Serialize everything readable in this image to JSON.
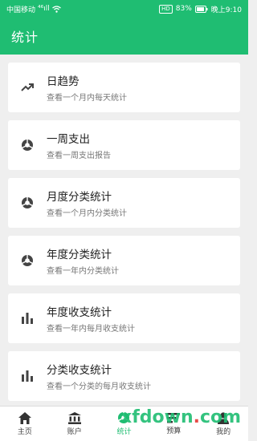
{
  "statusbar": {
    "carrier": "中国移动",
    "signal": "⁴⁶ıll",
    "wifi": "WiFi",
    "hd": "HD",
    "battery": "83%",
    "time": "晚上9:10"
  },
  "appbar": {
    "title": "统计"
  },
  "cards": [
    {
      "title": "日趋势",
      "subtitle": "查看一个月内每天统计",
      "icon": "trend-icon"
    },
    {
      "title": "一周支出",
      "subtitle": "查看一周支出报告",
      "icon": "pie-icon"
    },
    {
      "title": "月度分类统计",
      "subtitle": "查看一个月内分类统计",
      "icon": "pie-icon"
    },
    {
      "title": "年度分类统计",
      "subtitle": "查看一年内分类统计",
      "icon": "pie-icon"
    },
    {
      "title": "年度收支统计",
      "subtitle": "查看一年内每月收支统计",
      "icon": "bar-chart-icon"
    },
    {
      "title": "分类收支统计",
      "subtitle": "查看一个分类的每月收支统计",
      "icon": "bar-chart-icon"
    }
  ],
  "tabs": [
    {
      "label": "主页",
      "icon": "home-icon"
    },
    {
      "label": "账户",
      "icon": "bank-icon"
    },
    {
      "label": "统计",
      "icon": "stats-icon",
      "active": true
    },
    {
      "label": "预算",
      "icon": "budget-icon"
    },
    {
      "label": "我的",
      "icon": "user-icon"
    }
  ],
  "watermark": {
    "prefix": "xfdown",
    "dot": ".",
    "suffix": "com"
  },
  "colors": {
    "primary": "#1fbd72",
    "background": "#efefef"
  }
}
